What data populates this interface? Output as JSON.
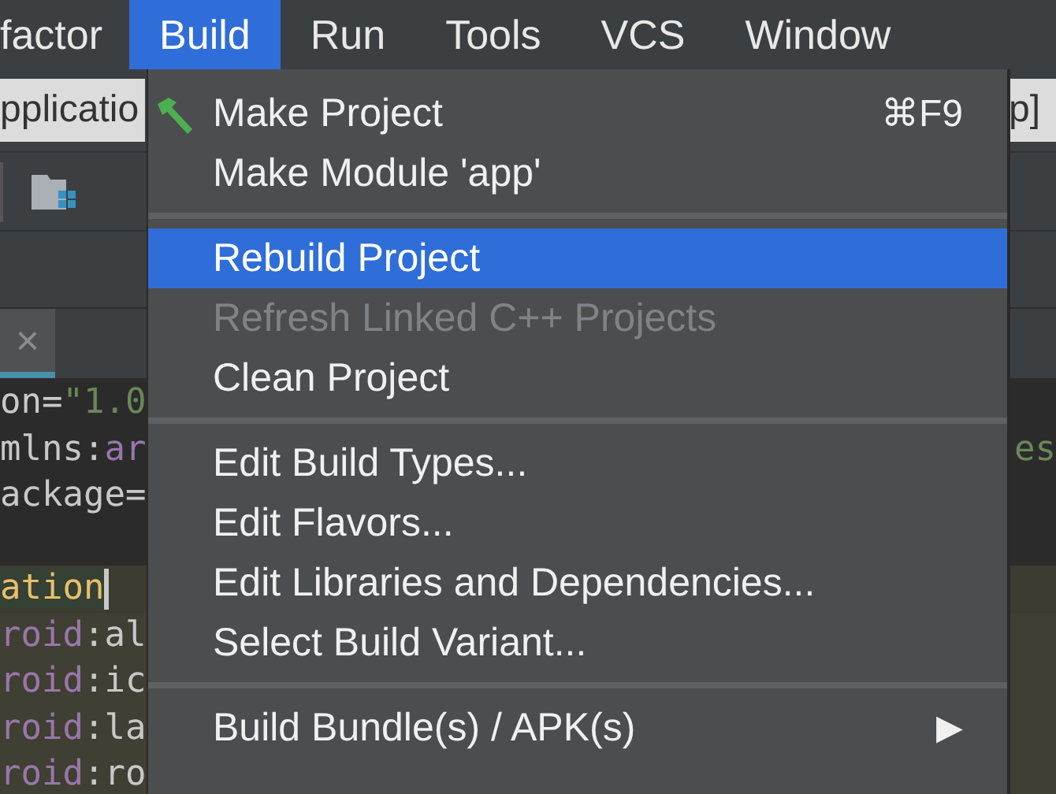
{
  "menu_bar": [
    {
      "label": "factor",
      "selected": false
    },
    {
      "label": "Build",
      "selected": true
    },
    {
      "label": "Run",
      "selected": false
    },
    {
      "label": "Tools",
      "selected": false
    },
    {
      "label": "VCS",
      "selected": false
    },
    {
      "label": "Window",
      "selected": false
    }
  ],
  "config_bar": {
    "left_text": "pplicatio",
    "right_text": "p]"
  },
  "editor_tab": {
    "close": "×"
  },
  "code_lines": [
    {
      "scope": false,
      "caret": false,
      "segments": [
        {
          "kind": "plain",
          "text": "on="
        },
        {
          "kind": "string",
          "text": "\"1.0"
        }
      ]
    },
    {
      "scope": false,
      "caret": false,
      "segments": [
        {
          "kind": "plain",
          "text": "mlns:"
        },
        {
          "kind": "attr",
          "text": "ar"
        }
      ],
      "right": "es"
    },
    {
      "scope": false,
      "caret": false,
      "segments": [
        {
          "kind": "plain",
          "text": "ackage="
        }
      ]
    },
    {
      "scope": false,
      "caret": false
    },
    {
      "scope": true,
      "caret": true,
      "segments": [
        {
          "kind": "tag",
          "text": "ation"
        }
      ]
    },
    {
      "scope": true,
      "caret": false,
      "segments": [
        {
          "kind": "attr",
          "text": "roid"
        },
        {
          "kind": "plain",
          "text": ":al"
        }
      ]
    },
    {
      "scope": true,
      "caret": false,
      "segments": [
        {
          "kind": "attr",
          "text": "roid"
        },
        {
          "kind": "plain",
          "text": ":ic"
        }
      ]
    },
    {
      "scope": true,
      "caret": false,
      "segments": [
        {
          "kind": "attr",
          "text": "roid"
        },
        {
          "kind": "plain",
          "text": ":la"
        }
      ]
    },
    {
      "scope": true,
      "caret": false,
      "segments": [
        {
          "kind": "attr",
          "text": "roid"
        },
        {
          "kind": "plain",
          "text": ":ro"
        }
      ]
    }
  ],
  "build_menu": [
    {
      "kind": "tool_item",
      "label": "Make Project",
      "shortcut": "⌘F9",
      "disabled": false,
      "selected": false
    },
    {
      "kind": "item",
      "label": "Make Module 'app'",
      "disabled": false,
      "selected": false
    },
    {
      "kind": "separator"
    },
    {
      "kind": "item",
      "label": "Rebuild Project",
      "disabled": false,
      "selected": true
    },
    {
      "kind": "item",
      "label": "Refresh Linked C++ Projects",
      "disabled": true,
      "selected": false
    },
    {
      "kind": "item",
      "label": "Clean Project",
      "disabled": false,
      "selected": false
    },
    {
      "kind": "separator"
    },
    {
      "kind": "item",
      "label": "Edit Build Types...",
      "disabled": false,
      "selected": false
    },
    {
      "kind": "item",
      "label": "Edit Flavors...",
      "disabled": false,
      "selected": false
    },
    {
      "kind": "item",
      "label": "Edit Libraries and Dependencies...",
      "disabled": false,
      "selected": false
    },
    {
      "kind": "item",
      "label": "Select Build Variant...",
      "disabled": false,
      "selected": false
    },
    {
      "kind": "separator"
    },
    {
      "kind": "item",
      "label": "Build Bundle(s) / APK(s)",
      "submenu": "▶",
      "disabled": false,
      "selected": false
    }
  ]
}
